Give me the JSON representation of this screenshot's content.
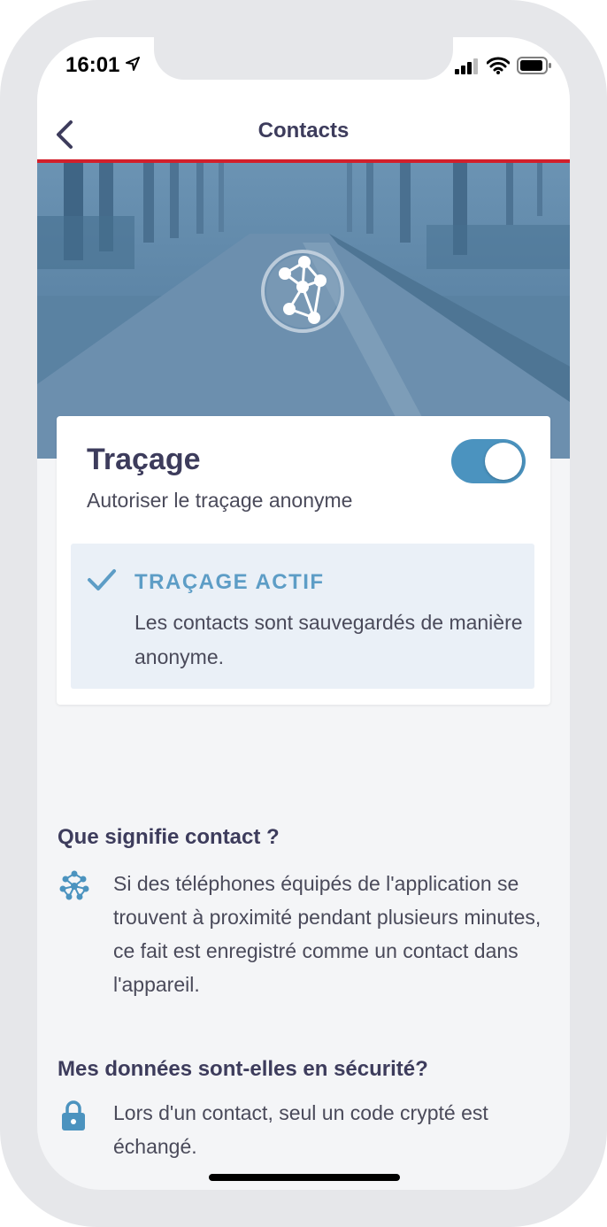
{
  "status_bar": {
    "time": "16:01"
  },
  "nav": {
    "title": "Contacts"
  },
  "tracing_card": {
    "title": "Traçage",
    "subtitle": "Autoriser le traçage anonyme",
    "toggle_on": true,
    "status": {
      "title": "TRAÇAGE ACTIF",
      "text": "Les contacts sont sauvegardés de manière anonyme."
    }
  },
  "faq": [
    {
      "heading": "Que signifie contact ?",
      "icon": "network-icon",
      "text": "Si des téléphones équipés de l'application se trouvent à proximité pendant plusieurs minutes, ce fait est enregistré comme un contact dans l'appareil."
    },
    {
      "heading": "Mes données sont-elles en sécurité?",
      "icon": "lock-icon",
      "text": "Lors d'un contact, seul un code crypté est échangé."
    }
  ],
  "colors": {
    "accent": "#4b93bf",
    "status_accent": "#5d9dc6",
    "nav_underline": "#d21f2b",
    "title_text": "#3d3c5c"
  }
}
